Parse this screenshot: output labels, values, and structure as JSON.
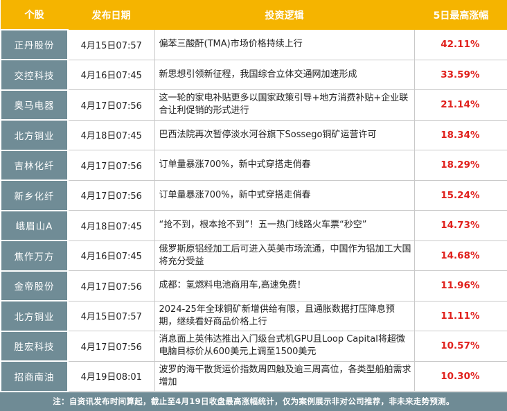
{
  "header": {
    "stock": "个股",
    "date": "发布日期",
    "logic": "投资逻辑",
    "gain": "5日最高涨幅"
  },
  "rows": [
    {
      "name": "正丹股份",
      "date": "4月15日07:57",
      "logic": "偏苯三酸酐(TMA)市场价格持续上行",
      "gain": "42.11%"
    },
    {
      "name": "交控科技",
      "date": "4月16日07:45",
      "logic": "新思想引领新征程，我国综合立体交通网加速形成",
      "gain": "33.59%"
    },
    {
      "name": "奥马电器",
      "date": "4月17日07:56",
      "logic": "这一轮的家电补贴更多以国家政策引导+地方消费补贴+企业联合让利促销的形式进行",
      "gain": "21.14%"
    },
    {
      "name": "北方铜业",
      "date": "4月18日07:45",
      "logic": "巴西法院再次暂停淡水河谷旗下Sossego铜矿运营许可",
      "gain": "18.34%"
    },
    {
      "name": "吉林化纤",
      "date": "4月17日07:56",
      "logic": "订单量暴涨700%，新中式穿搭走俏春",
      "gain": "18.29%"
    },
    {
      "name": "新乡化纤",
      "date": "4月17日07:56",
      "logic": "订单量暴涨700%，新中式穿搭走俏春",
      "gain": "15.24%"
    },
    {
      "name": "峨眉山A",
      "date": "4月18日07:45",
      "logic": "“抢不到，根本抢不到”！五一热门线路火车票“秒空”",
      "gain": "14.73%"
    },
    {
      "name": "焦作万方",
      "date": "4月16日07:45",
      "logic": "俄罗斯原铝经加工后可进入英美市场流通，中国作为铝加工大国将充分受益",
      "gain": "14.68%"
    },
    {
      "name": "金帝股份",
      "date": "4月17日07:56",
      "logic": "成都：氢燃料电池商用车,高速免费！",
      "gain": "11.96%"
    },
    {
      "name": "北方铜业",
      "date": "4月15日07:57",
      "logic": "2024-25年全球铜矿新增供给有限，且通胀数据打压降息预期，继续看好商品价格上行",
      "gain": "11.11%"
    },
    {
      "name": "胜宏科技",
      "date": "4月17日07:56",
      "logic": "消息面上英伟达推出入门级台式机GPU且Loop Capital将超微电脑目标价从600美元上调至1500美元",
      "gain": "10.57%"
    },
    {
      "name": "招商南油",
      "date": "4月19日08:01",
      "logic": "波罗的海干散货运价指数周四触及逾三周高位，各类型船舶需求增加",
      "gain": "10.30%"
    }
  ],
  "note": "注：自资讯发布时间算起，截止至4月19日收盘最高涨幅统计，仅为案例展示非对公司推荐，非未来走势预测。",
  "colors": {
    "header_bg": "#f5b400",
    "name_bg": "#708c96",
    "gain_text": "#e0201c",
    "note_bg": "#6f8b95"
  }
}
